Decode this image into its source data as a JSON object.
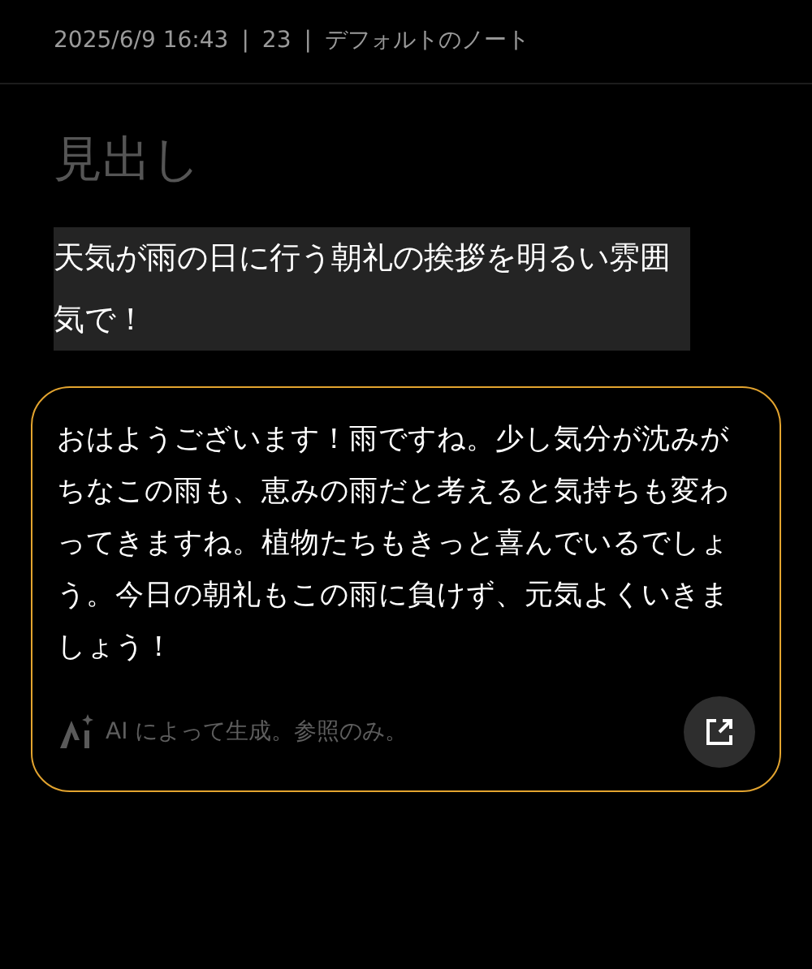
{
  "meta": {
    "date": "2025/6/9 16:43",
    "separator_1": "|",
    "count": "23",
    "separator_2": "|",
    "notebook": "デフォルトのノート"
  },
  "heading": {
    "placeholder": "見出し"
  },
  "prompt": {
    "text": "天気が雨の日に行う朝礼の挨拶を明るい雰囲気で！",
    "selected": true
  },
  "ai_card": {
    "response": "おはようございます！雨ですね。少し気分が沈みがちなこの雨も、恵みの雨だと考えると気持ちも変わってきますね。植物たちもきっと喜んでいるでしょう。今日の朝礼もこの雨に負けず、元気よくいきましょう！",
    "disclaimer": "AI によって生成。参照のみ。"
  }
}
